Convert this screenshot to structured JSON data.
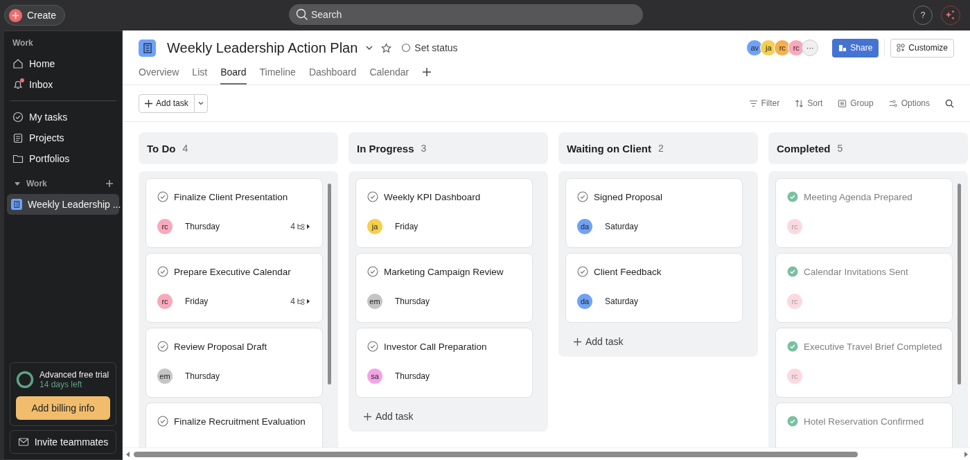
{
  "topbar": {
    "create_label": "Create",
    "search": {
      "placeholder": "Search"
    },
    "help_label": "?"
  },
  "sidebar": {
    "section_label": "Work",
    "nav_items": [
      {
        "label": "Home",
        "kind": "home",
        "badge": false
      },
      {
        "label": "Inbox",
        "kind": "inbox",
        "badge": true
      }
    ],
    "nav_items_2": [
      {
        "label": "My tasks",
        "kind": "tasks"
      },
      {
        "label": "Projects",
        "kind": "projects"
      },
      {
        "label": "Portfolios",
        "kind": "portfolios"
      }
    ],
    "group": {
      "label": "Work",
      "expanded": true,
      "projects": [
        {
          "label": "Weekly Leadership ...",
          "selected": true
        }
      ]
    },
    "trial": {
      "title": "Advanced free trial",
      "subtitle": "14 days left",
      "button": "Add billing info"
    },
    "invite_label": "Invite teammates"
  },
  "project": {
    "title": "Weekly Leadership Action Plan",
    "starred": false,
    "status_label": "Set status",
    "members": [
      {
        "initials": "av",
        "color": "#6fa2f5"
      },
      {
        "initials": "ja",
        "color": "#f5d04f"
      },
      {
        "initials": "rc",
        "color": "#f3b04c"
      },
      {
        "initials": "rc",
        "color": "#f8a9bb"
      }
    ],
    "more_members": "···",
    "share_label": "Share",
    "customize_label": "Customize",
    "tabs": [
      {
        "label": "Overview",
        "selected": false
      },
      {
        "label": "List",
        "selected": false
      },
      {
        "label": "Board",
        "selected": true
      },
      {
        "label": "Timeline",
        "selected": false
      },
      {
        "label": "Dashboard",
        "selected": false
      },
      {
        "label": "Calendar",
        "selected": false
      }
    ]
  },
  "toolbar": {
    "add_task_label": "Add task",
    "actions": [
      {
        "label": "Filter",
        "kind": "filter"
      },
      {
        "label": "Sort",
        "kind": "sort"
      },
      {
        "label": "Group",
        "kind": "group"
      },
      {
        "label": "Options",
        "kind": "options"
      }
    ]
  },
  "columns": [
    {
      "title": "To Do",
      "count": "4",
      "tasks": [
        {
          "title": "Finalize Client Presentation",
          "completed": false,
          "assignee": {
            "initials": "rc",
            "color": "#f8a9bb"
          },
          "due": "Thursday",
          "subtasks": "4"
        },
        {
          "title": "Prepare Executive Calendar",
          "completed": false,
          "assignee": {
            "initials": "rc",
            "color": "#f8a9bb"
          },
          "due": "Friday",
          "subtasks": "4"
        },
        {
          "title": "Review Proposal Draft",
          "completed": false,
          "assignee": {
            "initials": "em",
            "color": "#c5c5c5"
          },
          "due": "Thursday"
        },
        {
          "title": "Finalize Recruitment Evaluation",
          "completed": false
        }
      ]
    },
    {
      "title": "In Progress",
      "count": "3",
      "add_task": "Add task",
      "tasks": [
        {
          "title": "Weekly KPI Dashboard",
          "completed": false,
          "assignee": {
            "initials": "ja",
            "color": "#f5d04f"
          },
          "due": "Friday"
        },
        {
          "title": "Marketing Campaign Review",
          "completed": false,
          "assignee": {
            "initials": "em",
            "color": "#c5c5c5"
          },
          "due": "Thursday"
        },
        {
          "title": "Investor Call Preparation",
          "completed": false,
          "assignee": {
            "initials": "sa",
            "color": "#f4a4e4"
          },
          "due": "Thursday"
        }
      ]
    },
    {
      "title": "Waiting on Client",
      "count": "2",
      "add_task": "Add task",
      "tasks": [
        {
          "title": "Signed Proposal",
          "completed": false,
          "assignee": {
            "initials": "da",
            "color": "#6fa2f5"
          },
          "due": "Saturday"
        },
        {
          "title": "Client Feedback",
          "completed": false,
          "assignee": {
            "initials": "da",
            "color": "#6fa2f5"
          },
          "due": "Saturday"
        }
      ]
    },
    {
      "title": "Completed",
      "count": "5",
      "tasks": [
        {
          "title": "Meeting Agenda Prepared",
          "completed": true,
          "assignee": {
            "initials": "rc",
            "color": "#fcd9e1"
          }
        },
        {
          "title": "Calendar Invitations Sent",
          "completed": true,
          "assignee": {
            "initials": "rc",
            "color": "#fcd9e1"
          }
        },
        {
          "title": "Executive Travel Brief Completed",
          "completed": true,
          "assignee": {
            "initials": "rc",
            "color": "#fcd9e1"
          }
        },
        {
          "title": "Hotel Reservation Confirmed",
          "completed": true
        }
      ]
    }
  ]
}
